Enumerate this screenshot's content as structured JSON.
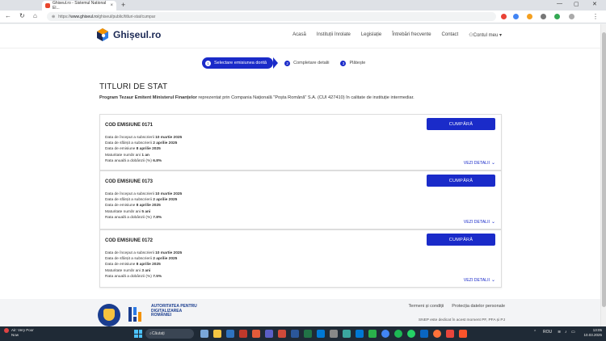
{
  "browser": {
    "tab_title": "Ghiseul.ro - Sistemul National El...",
    "url_prefix": "https://",
    "url_domain": "www.ghiseul.ro",
    "url_path": "/ghiseul/public/titluri-stat/cumpar"
  },
  "header": {
    "logo_text": "Ghișeul.ro",
    "nav": [
      "Acasă",
      "Instituții înrolate",
      "Legislație",
      "Întrebări frecvente",
      "Contact",
      "Contul meu"
    ]
  },
  "steps": [
    {
      "num": "1",
      "label": "Selectare emisiunea dorită"
    },
    {
      "num": "2",
      "label": "Completare detalii"
    },
    {
      "num": "3",
      "label": "Plătește"
    }
  ],
  "page": {
    "title": "TITLURI DE STAT",
    "subtitle_bold": "Program Tezaur Emitent Ministerul Finanțelor",
    "subtitle_rest": " reprezentat prin Compania Națională \"Poșta Română\" S.A. (CUI 427410) în calitate de instituție intermediar."
  },
  "cards": [
    {
      "title": "COD EMISIUNE 0171",
      "buy": "CUMPĂRĂ",
      "details": "VEZI DETALII",
      "lines": [
        {
          "label": "Data de început a subscrierii ",
          "value": "10 martie 2025"
        },
        {
          "label": "Data de sfârșit a subscrierii ",
          "value": "2 aprilie 2025"
        },
        {
          "label": "Data de emisiune ",
          "value": "8 aprilie 2025"
        },
        {
          "label": "Maturitate număr ani ",
          "value": "1 an"
        },
        {
          "label": "Rata anuală a dobânzii (%) ",
          "value": "6.8%"
        }
      ]
    },
    {
      "title": "COD EMISIUNE 0173",
      "buy": "CUMPĂRĂ",
      "details": "VEZI DETALII",
      "lines": [
        {
          "label": "Data de început a subscrierii ",
          "value": "10 martie 2025"
        },
        {
          "label": "Data de sfârșit a subscrierii ",
          "value": "2 aprilie 2025"
        },
        {
          "label": "Data de emisiune ",
          "value": "8 aprilie 2025"
        },
        {
          "label": "Maturitate număr ani ",
          "value": "5 ani"
        },
        {
          "label": "Rata anuală a dobânzii (%) ",
          "value": "7.8%"
        }
      ]
    },
    {
      "title": "COD EMISIUNE 0172",
      "buy": "CUMPĂRĂ",
      "details": "VEZI DETALII",
      "lines": [
        {
          "label": "Data de început a subscrierii ",
          "value": "10 martie 2025"
        },
        {
          "label": "Data de sfârșit a subscrierii ",
          "value": "2 aprilie 2025"
        },
        {
          "label": "Data de emisiune ",
          "value": "8 aprilie 2025"
        },
        {
          "label": "Maturitate număr ani ",
          "value": "3 ani"
        },
        {
          "label": "Rata anuală a dobânzii (%) ",
          "value": "7.5%"
        }
      ]
    }
  ],
  "footer": {
    "adr_text": "AUTORITATEA PENTRU DIGITALIZAREA ROMÂNIEI",
    "links": [
      "Termeni și condiții",
      "Protecția datelor personale"
    ],
    "note": "SNEP este dedicat în acest moment PF, PFA și PJ"
  },
  "taskbar": {
    "weather_line1": "Air: Very Poor",
    "weather_line2": "Now",
    "search_label": "Căutați",
    "lang": "ROU",
    "time": "13:05",
    "date": "10.03.2025"
  },
  "colors": {
    "primary": "#1a2bc9",
    "logo_navy": "#1c2955",
    "logo_orange": "#f39200",
    "logo_blue": "#2d7be5"
  }
}
